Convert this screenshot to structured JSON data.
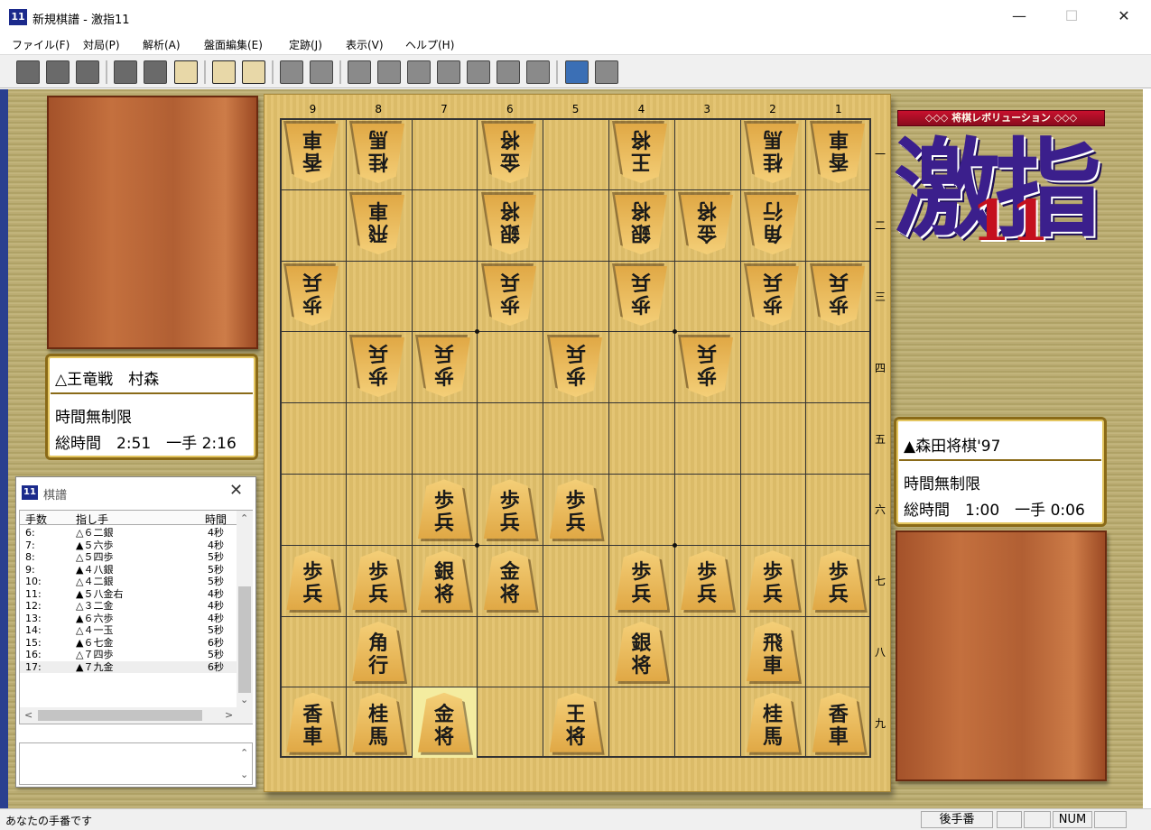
{
  "window": {
    "title": "新規棋譜 - 激指11",
    "icon_label": "11",
    "minimize": "—",
    "maximize": "☐",
    "close": "✕"
  },
  "menu": [
    "ファイル(F)",
    "対局(P)",
    "解析(A)",
    "盤面編集(E)",
    "定跡(J)",
    "表示(V)",
    "ヘルプ(H)"
  ],
  "toolbar_icons": [
    "new-file-icon",
    "open-file-icon",
    "save-file-icon",
    "undo-icon",
    "redo-icon",
    "board-edit-icon",
    "clock-icon",
    "hand-icon",
    "notation-icon",
    "notation-marked-icon",
    "back-to-start-icon",
    "back-10-icon",
    "back-1-icon",
    "stop-icon",
    "forward-1-icon",
    "forward-10-icon",
    "forward-to-end-icon",
    "computer-icon",
    "help-icon"
  ],
  "board": {
    "column_labels": [
      "9",
      "8",
      "7",
      "6",
      "5",
      "4",
      "3",
      "2",
      "1"
    ],
    "row_labels": [
      "一",
      "二",
      "三",
      "四",
      "五",
      "六",
      "七",
      "八",
      "九"
    ],
    "highlight": {
      "col": 7,
      "row": 9
    },
    "pieces": [
      {
        "col": 9,
        "row": 1,
        "owner": "gote",
        "top": "香",
        "bottom": "車"
      },
      {
        "col": 8,
        "row": 1,
        "owner": "gote",
        "top": "桂",
        "bottom": "馬"
      },
      {
        "col": 6,
        "row": 1,
        "owner": "gote",
        "top": "金",
        "bottom": "将"
      },
      {
        "col": 4,
        "row": 1,
        "owner": "gote",
        "top": "王",
        "bottom": "将"
      },
      {
        "col": 2,
        "row": 1,
        "owner": "gote",
        "top": "桂",
        "bottom": "馬"
      },
      {
        "col": 1,
        "row": 1,
        "owner": "gote",
        "top": "香",
        "bottom": "車"
      },
      {
        "col": 8,
        "row": 2,
        "owner": "gote",
        "top": "飛",
        "bottom": "車"
      },
      {
        "col": 6,
        "row": 2,
        "owner": "gote",
        "top": "銀",
        "bottom": "将"
      },
      {
        "col": 4,
        "row": 2,
        "owner": "gote",
        "top": "銀",
        "bottom": "将"
      },
      {
        "col": 3,
        "row": 2,
        "owner": "gote",
        "top": "金",
        "bottom": "将"
      },
      {
        "col": 2,
        "row": 2,
        "owner": "gote",
        "top": "角",
        "bottom": "行"
      },
      {
        "col": 9,
        "row": 3,
        "owner": "gote",
        "top": "歩",
        "bottom": "兵"
      },
      {
        "col": 6,
        "row": 3,
        "owner": "gote",
        "top": "歩",
        "bottom": "兵"
      },
      {
        "col": 4,
        "row": 3,
        "owner": "gote",
        "top": "歩",
        "bottom": "兵"
      },
      {
        "col": 2,
        "row": 3,
        "owner": "gote",
        "top": "歩",
        "bottom": "兵"
      },
      {
        "col": 1,
        "row": 3,
        "owner": "gote",
        "top": "歩",
        "bottom": "兵"
      },
      {
        "col": 8,
        "row": 4,
        "owner": "gote",
        "top": "歩",
        "bottom": "兵"
      },
      {
        "col": 7,
        "row": 4,
        "owner": "gote",
        "top": "歩",
        "bottom": "兵"
      },
      {
        "col": 5,
        "row": 4,
        "owner": "gote",
        "top": "歩",
        "bottom": "兵"
      },
      {
        "col": 3,
        "row": 4,
        "owner": "gote",
        "top": "歩",
        "bottom": "兵"
      },
      {
        "col": 7,
        "row": 6,
        "owner": "sente",
        "top": "歩",
        "bottom": "兵"
      },
      {
        "col": 6,
        "row": 6,
        "owner": "sente",
        "top": "歩",
        "bottom": "兵"
      },
      {
        "col": 5,
        "row": 6,
        "owner": "sente",
        "top": "歩",
        "bottom": "兵"
      },
      {
        "col": 9,
        "row": 7,
        "owner": "sente",
        "top": "歩",
        "bottom": "兵"
      },
      {
        "col": 8,
        "row": 7,
        "owner": "sente",
        "top": "歩",
        "bottom": "兵"
      },
      {
        "col": 7,
        "row": 7,
        "owner": "sente",
        "top": "銀",
        "bottom": "将"
      },
      {
        "col": 6,
        "row": 7,
        "owner": "sente",
        "top": "金",
        "bottom": "将"
      },
      {
        "col": 4,
        "row": 7,
        "owner": "sente",
        "top": "歩",
        "bottom": "兵"
      },
      {
        "col": 3,
        "row": 7,
        "owner": "sente",
        "top": "歩",
        "bottom": "兵"
      },
      {
        "col": 2,
        "row": 7,
        "owner": "sente",
        "top": "歩",
        "bottom": "兵"
      },
      {
        "col": 1,
        "row": 7,
        "owner": "sente",
        "top": "歩",
        "bottom": "兵"
      },
      {
        "col": 8,
        "row": 8,
        "owner": "sente",
        "top": "角",
        "bottom": "行"
      },
      {
        "col": 4,
        "row": 8,
        "owner": "sente",
        "top": "銀",
        "bottom": "将"
      },
      {
        "col": 2,
        "row": 8,
        "owner": "sente",
        "top": "飛",
        "bottom": "車"
      },
      {
        "col": 9,
        "row": 9,
        "owner": "sente",
        "top": "香",
        "bottom": "車"
      },
      {
        "col": 8,
        "row": 9,
        "owner": "sente",
        "top": "桂",
        "bottom": "馬"
      },
      {
        "col": 7,
        "row": 9,
        "owner": "sente",
        "top": "金",
        "bottom": "将"
      },
      {
        "col": 5,
        "row": 9,
        "owner": "sente",
        "top": "王",
        "bottom": "将"
      },
      {
        "col": 2,
        "row": 9,
        "owner": "sente",
        "top": "桂",
        "bottom": "馬"
      },
      {
        "col": 1,
        "row": 9,
        "owner": "sente",
        "top": "香",
        "bottom": "車"
      }
    ]
  },
  "gote_player": {
    "name": "△王竜戦　村森",
    "time_limit": "時間無制限",
    "time_used": "総時間　2:51　一手 2:16"
  },
  "sente_player": {
    "name": "▲森田将棋'97",
    "time_limit": "時間無制限",
    "time_used": "総時間　1:00　一手 0:06"
  },
  "logo": {
    "ribbon": "◇◇◇ 将棋レボリューション ◇◇◇",
    "big": "激指",
    "num": "11"
  },
  "kifu": {
    "title": "棋譜",
    "close": "✕",
    "columns": [
      "手数",
      "指し手",
      "時間"
    ],
    "rows": [
      [
        "6:",
        "△６二銀",
        "4秒"
      ],
      [
        "7:",
        "▲５六歩",
        "4秒"
      ],
      [
        "8:",
        "△５四歩",
        "5秒"
      ],
      [
        "9:",
        "▲４八銀",
        "5秒"
      ],
      [
        "10:",
        "△４二銀",
        "5秒"
      ],
      [
        "11:",
        "▲５八金右",
        "4秒"
      ],
      [
        "12:",
        "△３二金",
        "4秒"
      ],
      [
        "13:",
        "▲６六歩",
        "4秒"
      ],
      [
        "14:",
        "△４一玉",
        "5秒"
      ],
      [
        "15:",
        "▲６七金",
        "6秒"
      ],
      [
        "16:",
        "△７四歩",
        "5秒"
      ],
      [
        "17:",
        "▲７九金",
        "6秒"
      ]
    ]
  },
  "status": {
    "message": "あなたの手番です",
    "turn": "後手番",
    "num": "NUM"
  }
}
